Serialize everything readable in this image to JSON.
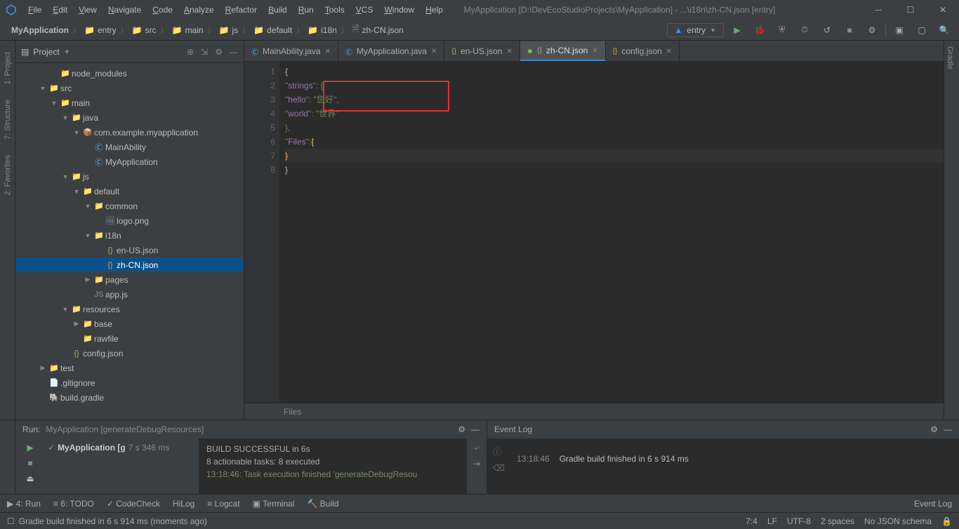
{
  "title": "MyApplication [D:\\DevEcoStudioProjects\\MyApplication] - ...\\i18n\\zh-CN.json [entry]",
  "menus": [
    "File",
    "Edit",
    "View",
    "Navigate",
    "Code",
    "Analyze",
    "Refactor",
    "Build",
    "Run",
    "Tools",
    "VCS",
    "Window",
    "Help"
  ],
  "breadcrumb": [
    "MyApplication",
    "entry",
    "src",
    "main",
    "js",
    "default",
    "i18n",
    "zh-CN.json"
  ],
  "runConfig": "entry",
  "sidebar_left": [
    "1: Project",
    "7: Structure",
    "2: Favorites"
  ],
  "sidebar_right": [
    "Gradle"
  ],
  "projectPanel": {
    "title": "Project"
  },
  "tree": [
    {
      "indent": 3,
      "arrow": "",
      "icon": "folder",
      "label": "node_modules"
    },
    {
      "indent": 2,
      "arrow": "▼",
      "icon": "folder",
      "label": "src"
    },
    {
      "indent": 3,
      "arrow": "▼",
      "icon": "folder",
      "label": "main"
    },
    {
      "indent": 4,
      "arrow": "▼",
      "icon": "folder",
      "label": "java"
    },
    {
      "indent": 5,
      "arrow": "▼",
      "icon": "pkg",
      "label": "com.example.myapplication"
    },
    {
      "indent": 6,
      "arrow": "",
      "icon": "class",
      "label": "MainAbility"
    },
    {
      "indent": 6,
      "arrow": "",
      "icon": "class",
      "label": "MyApplication"
    },
    {
      "indent": 4,
      "arrow": "▼",
      "icon": "folder",
      "label": "js"
    },
    {
      "indent": 5,
      "arrow": "▼",
      "icon": "folder",
      "label": "default"
    },
    {
      "indent": 6,
      "arrow": "▼",
      "icon": "folder",
      "label": "common"
    },
    {
      "indent": 7,
      "arrow": "",
      "icon": "img",
      "label": "logo.png"
    },
    {
      "indent": 6,
      "arrow": "▼",
      "icon": "folder",
      "label": "i18n"
    },
    {
      "indent": 7,
      "arrow": "",
      "icon": "json",
      "label": "en-US.json"
    },
    {
      "indent": 7,
      "arrow": "",
      "icon": "json",
      "label": "zh-CN.json",
      "selected": true
    },
    {
      "indent": 6,
      "arrow": "▶",
      "icon": "folder",
      "label": "pages"
    },
    {
      "indent": 6,
      "arrow": "",
      "icon": "js",
      "label": "app.js"
    },
    {
      "indent": 4,
      "arrow": "▼",
      "icon": "folder",
      "label": "resources"
    },
    {
      "indent": 5,
      "arrow": "▶",
      "icon": "folder",
      "label": "base"
    },
    {
      "indent": 5,
      "arrow": "",
      "icon": "folder",
      "label": "rawfile"
    },
    {
      "indent": 4,
      "arrow": "",
      "icon": "json",
      "label": "config.json"
    },
    {
      "indent": 2,
      "arrow": "▶",
      "icon": "folder",
      "label": "test"
    },
    {
      "indent": 2,
      "arrow": "",
      "icon": "file",
      "label": ".gitignore"
    },
    {
      "indent": 2,
      "arrow": "",
      "icon": "gradle",
      "label": "build.gradle"
    }
  ],
  "tabs": [
    {
      "label": "MainAbility.java",
      "icon": "class"
    },
    {
      "label": "MyApplication.java",
      "icon": "class"
    },
    {
      "label": "en-US.json",
      "icon": "json"
    },
    {
      "label": "zh-CN.json",
      "icon": "json",
      "active": true,
      "dirty": true
    },
    {
      "label": "config.json",
      "icon": "json"
    }
  ],
  "code": {
    "lines": [
      "1",
      "2",
      "3",
      "4",
      "5",
      "6",
      "7",
      "8"
    ],
    "l1": "{",
    "l2a": "  \"",
    "l2b": "strings",
    "l2c": "\": {",
    "l3a": "    \"",
    "l3b": "hello",
    "l3c": "\": \"",
    "l3d": "您好",
    "l3e": "\",",
    "l4a": "    \"",
    "l4b": "world",
    "l4c": "\": \"",
    "l4d": "世界",
    "l4e": "\"",
    "l5": "  },",
    "l6a": "  \"",
    "l6b": "Files",
    "l6c": "\": ",
    "l6d": "{",
    "l7": "    }",
    "l8": "}"
  },
  "breadbar": "Files",
  "runPanel": {
    "title": "Run:",
    "config": "MyApplication [generateDebugResources]",
    "treeRoot": "MyApplication [g",
    "treeTime": "7 s 346 ms",
    "out1": "BUILD SUCCESSFUL in 6s",
    "out2": "8 actionable tasks: 8 executed",
    "out3": "13:18:46: Task execution finished 'generateDebugResou"
  },
  "eventLog": {
    "title": "Event Log",
    "time": "13:18:46",
    "msg": "Gradle build finished in 6 s 914 ms"
  },
  "bottomTabs": {
    "run": "4: Run",
    "todo": "6: TODO",
    "codecheck": "CodeCheck",
    "hilog": "HiLog",
    "logcat": "Logcat",
    "terminal": "Terminal",
    "build": "Build",
    "eventlog": "Event Log"
  },
  "status": {
    "msg": "Gradle build finished in 6 s 914 ms (moments ago)",
    "pos": "7:4",
    "le": "LF",
    "enc": "UTF-8",
    "indent": "2 spaces",
    "schema": "No JSON schema"
  }
}
